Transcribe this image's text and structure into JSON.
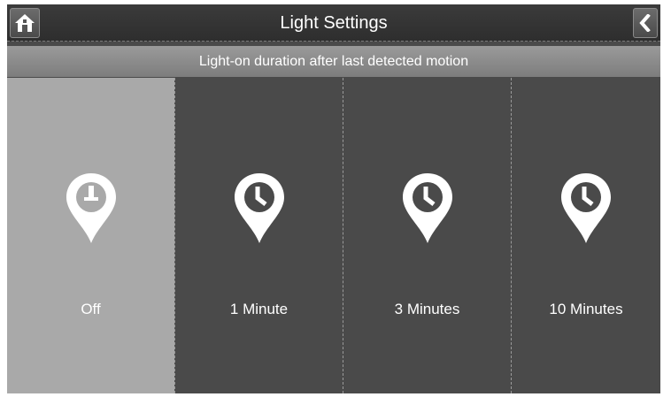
{
  "header": {
    "title": "Light Settings",
    "home_icon": "home-icon",
    "back_icon": "back-chevron-icon"
  },
  "subtitle": "Light-on duration after last detected motion",
  "options": [
    {
      "label": "Off",
      "icon": "clock-off-pin-icon",
      "selected": true
    },
    {
      "label": "1 Minute",
      "icon": "clock-pin-icon",
      "selected": false
    },
    {
      "label": "3 Minutes",
      "icon": "clock-pin-icon",
      "selected": false
    },
    {
      "label": "10 Minutes",
      "icon": "clock-pin-icon",
      "selected": false
    }
  ],
  "colors": {
    "selected_bg": "#a9a9a9",
    "option_bg": "#4a4a4a",
    "header_bg": "#2e2e2e",
    "subbar_bg": "#8a8a8a"
  }
}
